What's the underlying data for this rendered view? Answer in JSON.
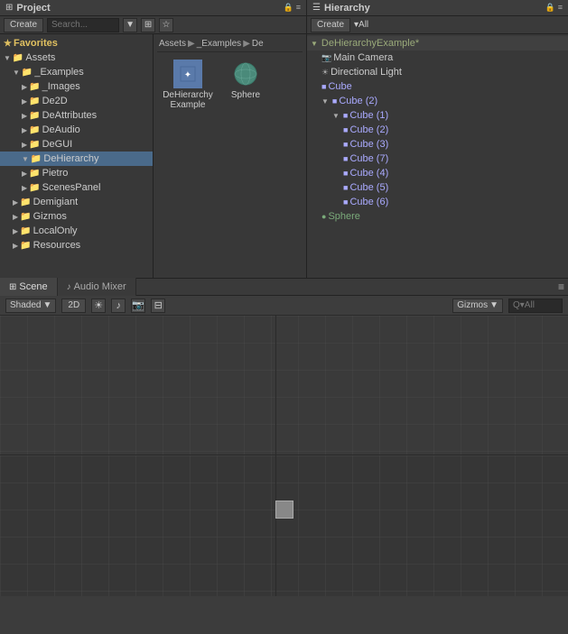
{
  "project_panel": {
    "title": "Project",
    "create_label": "Create",
    "favorites_label": "Favorites",
    "assets_label": "Assets",
    "examples_label": "_Examples",
    "images_label": "_Images",
    "de2d_label": "De2D",
    "deattributes_label": "DeAttributes",
    "deaudio_label": "DeAudio",
    "degui_label": "DeGUI",
    "dehierarchy_label": "DeHierarchy",
    "pietro_label": "Pietro",
    "scenespanel_label": "ScenesPanel",
    "demigiant_label": "Demigiant",
    "gizmos_label": "Gizmos",
    "localonly_label": "LocalOnly",
    "resources_label": "Resources"
  },
  "breadcrumb": {
    "assets": "Assets",
    "sep1": "▶",
    "examples": "_Examples",
    "sep2": "▶",
    "de": "De"
  },
  "file_panel": {
    "scene_file": "DeHierarchyExample",
    "sphere_file": "Sphere"
  },
  "hierarchy_panel": {
    "title": "Hierarchy",
    "create_label": "Create",
    "all_label": "▾All",
    "scene_name": "DeHierarchyExample*",
    "items": [
      {
        "label": "Main Camera",
        "indent": 1,
        "type": "normal"
      },
      {
        "label": "Directional Light",
        "indent": 1,
        "type": "normal"
      },
      {
        "label": "Cube",
        "indent": 1,
        "type": "cube"
      },
      {
        "label": "Cube (2)",
        "indent": 1,
        "type": "cube",
        "has_arrow": true
      },
      {
        "label": "Cube (1)",
        "indent": 2,
        "type": "cube",
        "has_arrow": true
      },
      {
        "label": "Cube (2)",
        "indent": 3,
        "type": "cube"
      },
      {
        "label": "Cube (3)",
        "indent": 3,
        "type": "cube"
      },
      {
        "label": "Cube (7)",
        "indent": 3,
        "type": "cube"
      },
      {
        "label": "Cube (4)",
        "indent": 3,
        "type": "cube"
      },
      {
        "label": "Cube (5)",
        "indent": 3,
        "type": "cube"
      },
      {
        "label": "Cube (6)",
        "indent": 3,
        "type": "cube"
      },
      {
        "label": "Sphere",
        "indent": 1,
        "type": "sphere"
      }
    ]
  },
  "scene_panel": {
    "tab_scene": "Scene",
    "tab_audio": "Audio Mixer",
    "shaded": "Shaded",
    "twod": "2D",
    "gizmos": "Gizmos",
    "search_placeholder": "Q▾All"
  },
  "icons": {
    "star": "★",
    "folder": "📁",
    "arrow_right": "▶",
    "arrow_down": "▼",
    "triangle_grid": "⊞",
    "sun": "☀",
    "speaker": "♪",
    "camera": "📷",
    "layers": "⊟",
    "more": "⋯",
    "gear": "⚙",
    "lock": "🔒",
    "overflow": "≡",
    "search": "🔍"
  }
}
